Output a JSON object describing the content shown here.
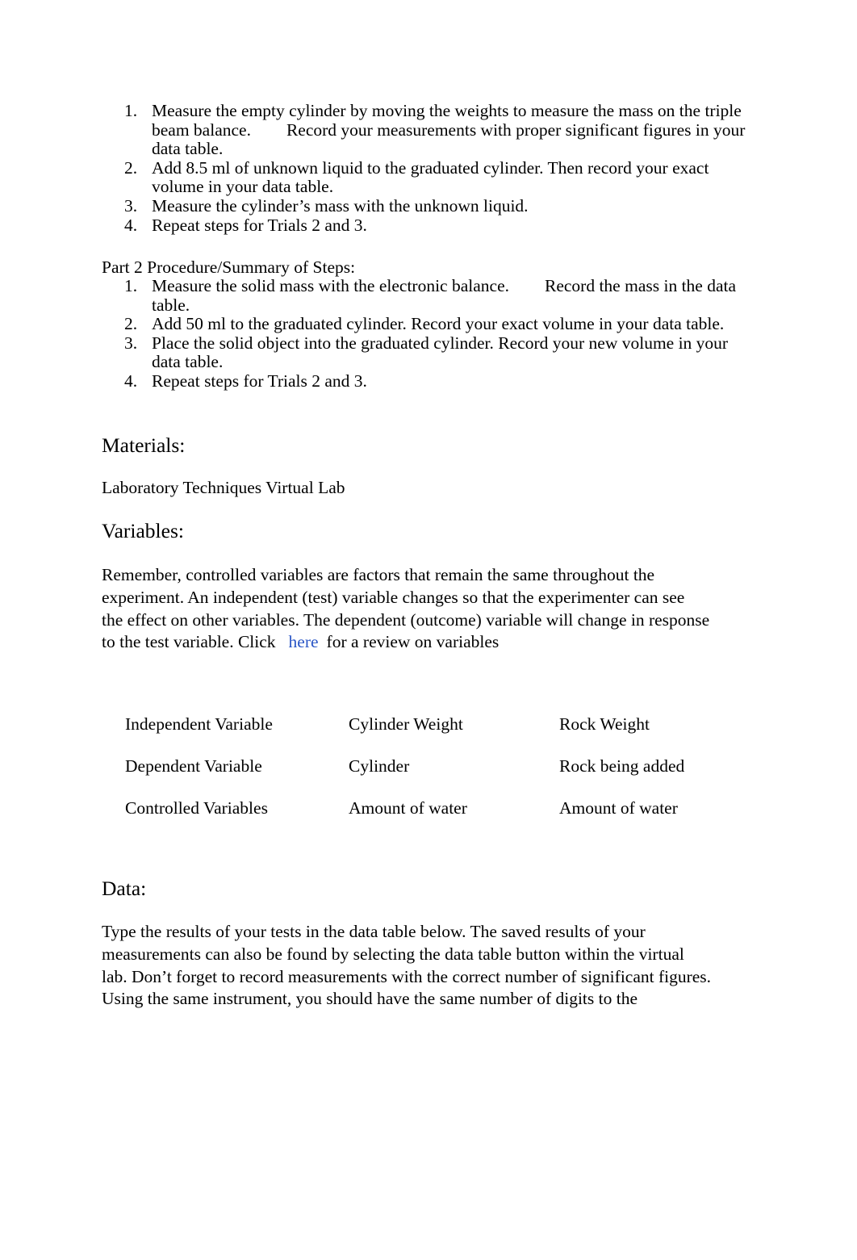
{
  "document": {
    "part1_steps": [
      {
        "number": "1.",
        "text_a": "Measure the empty cylinder by moving the weights to measure the mass on the triple beam balance.",
        "text_b": "Record your measurements with proper significant figures in your data table."
      },
      {
        "number": "2.",
        "text_a": "Add 8.5 ml of unknown liquid to the graduated cylinder. Then record your exact volume in your data table.",
        "text_b": ""
      },
      {
        "number": "3.",
        "text_a": "Measure the cylinder’s mass with the unknown liquid.",
        "text_b": ""
      },
      {
        "number": "4.",
        "text_a": "Repeat steps for Trials 2 and 3.",
        "text_b": ""
      }
    ],
    "part2_title": "Part 2 Procedure/Summary of Steps:",
    "part2_steps": [
      {
        "number": "1.",
        "text_a": "Measure the solid mass with the electronic balance.",
        "text_b": "Record the mass in the data table."
      },
      {
        "number": "2.",
        "text_a": "Add 50 ml to the graduated cylinder. Record your exact volume in your data table.",
        "text_b": ""
      },
      {
        "number": "3.",
        "text_a": "Place the solid object into the graduated cylinder. Record your new volume in your data table.",
        "text_b": ""
      },
      {
        "number": "4.",
        "text_a": "Repeat steps for Trials 2 and 3.",
        "text_b": ""
      }
    ],
    "materials": {
      "heading": "Materials:",
      "body": "Laboratory Techniques Virtual Lab"
    },
    "variables": {
      "heading": "Variables:",
      "paragraph_line1": "Remember, controlled variables are factors that remain the same throughout the",
      "paragraph_line2": "experiment. An independent (test) variable changes so that the experimenter can see",
      "paragraph_line3": "the effect on other variables. The dependent (outcome) variable will change in response",
      "paragraph_line4_pre": "to the test variable. Click",
      "link_text": "here",
      "paragraph_line4_post": "for a review on variables",
      "link_color": "#2a56c6",
      "rows": [
        {
          "label": "Independent Variable",
          "cylinder": "Cylinder Weight",
          "rock": "Rock Weight"
        },
        {
          "label": "Dependent Variable",
          "cylinder": "Cylinder",
          "rock": "Rock being added"
        },
        {
          "label": "Controlled Variables",
          "cylinder": "Amount of water",
          "rock": "Amount of water"
        }
      ]
    },
    "data": {
      "heading": "Data:",
      "paragraph_line1": "Type the results of your tests in the data table below. The saved results of your",
      "paragraph_line2": "measurements can also be found by selecting the data table button within the virtual",
      "paragraph_line3": "lab. Don’t forget to record measurements with the correct number of significant figures.",
      "paragraph_line4": "Using the same instrument, you should have the same number of digits to the"
    }
  }
}
